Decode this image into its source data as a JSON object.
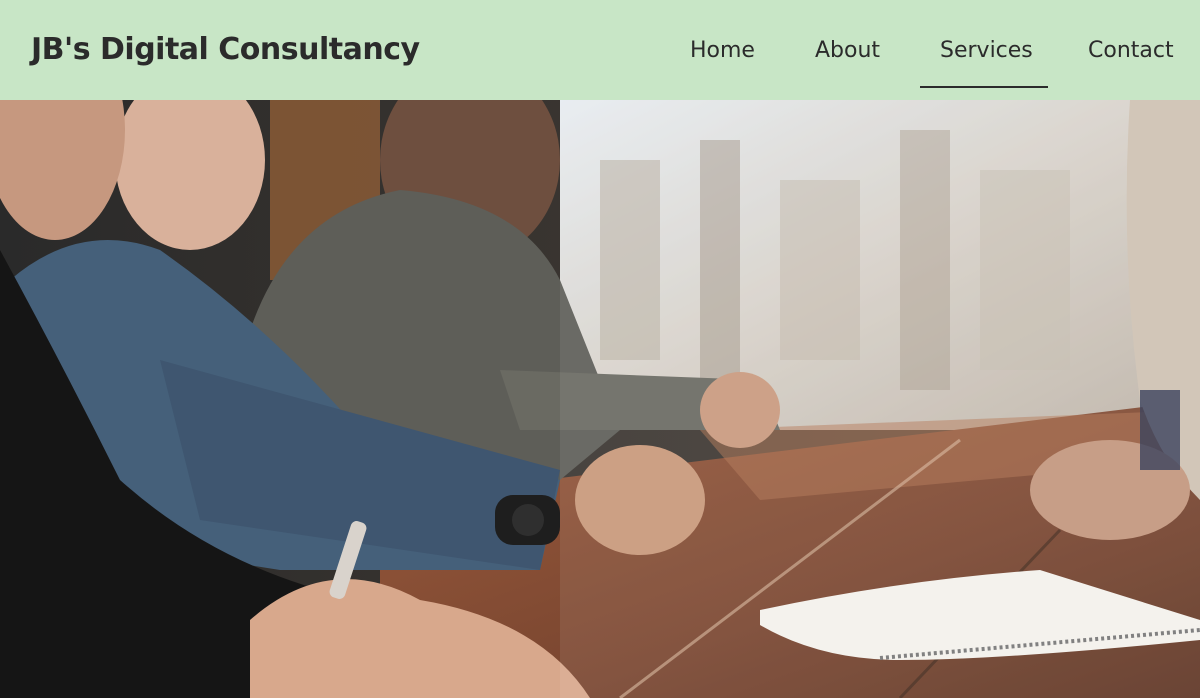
{
  "header": {
    "brand": "JB's Digital Consultancy",
    "background": "#c8e6c6",
    "nav": [
      {
        "label": "Home",
        "active": false
      },
      {
        "label": "About",
        "active": false
      },
      {
        "label": "Services",
        "active": true
      },
      {
        "label": "Contact",
        "active": false
      }
    ]
  },
  "hero": {
    "image_subject": "team-meeting-photo"
  }
}
